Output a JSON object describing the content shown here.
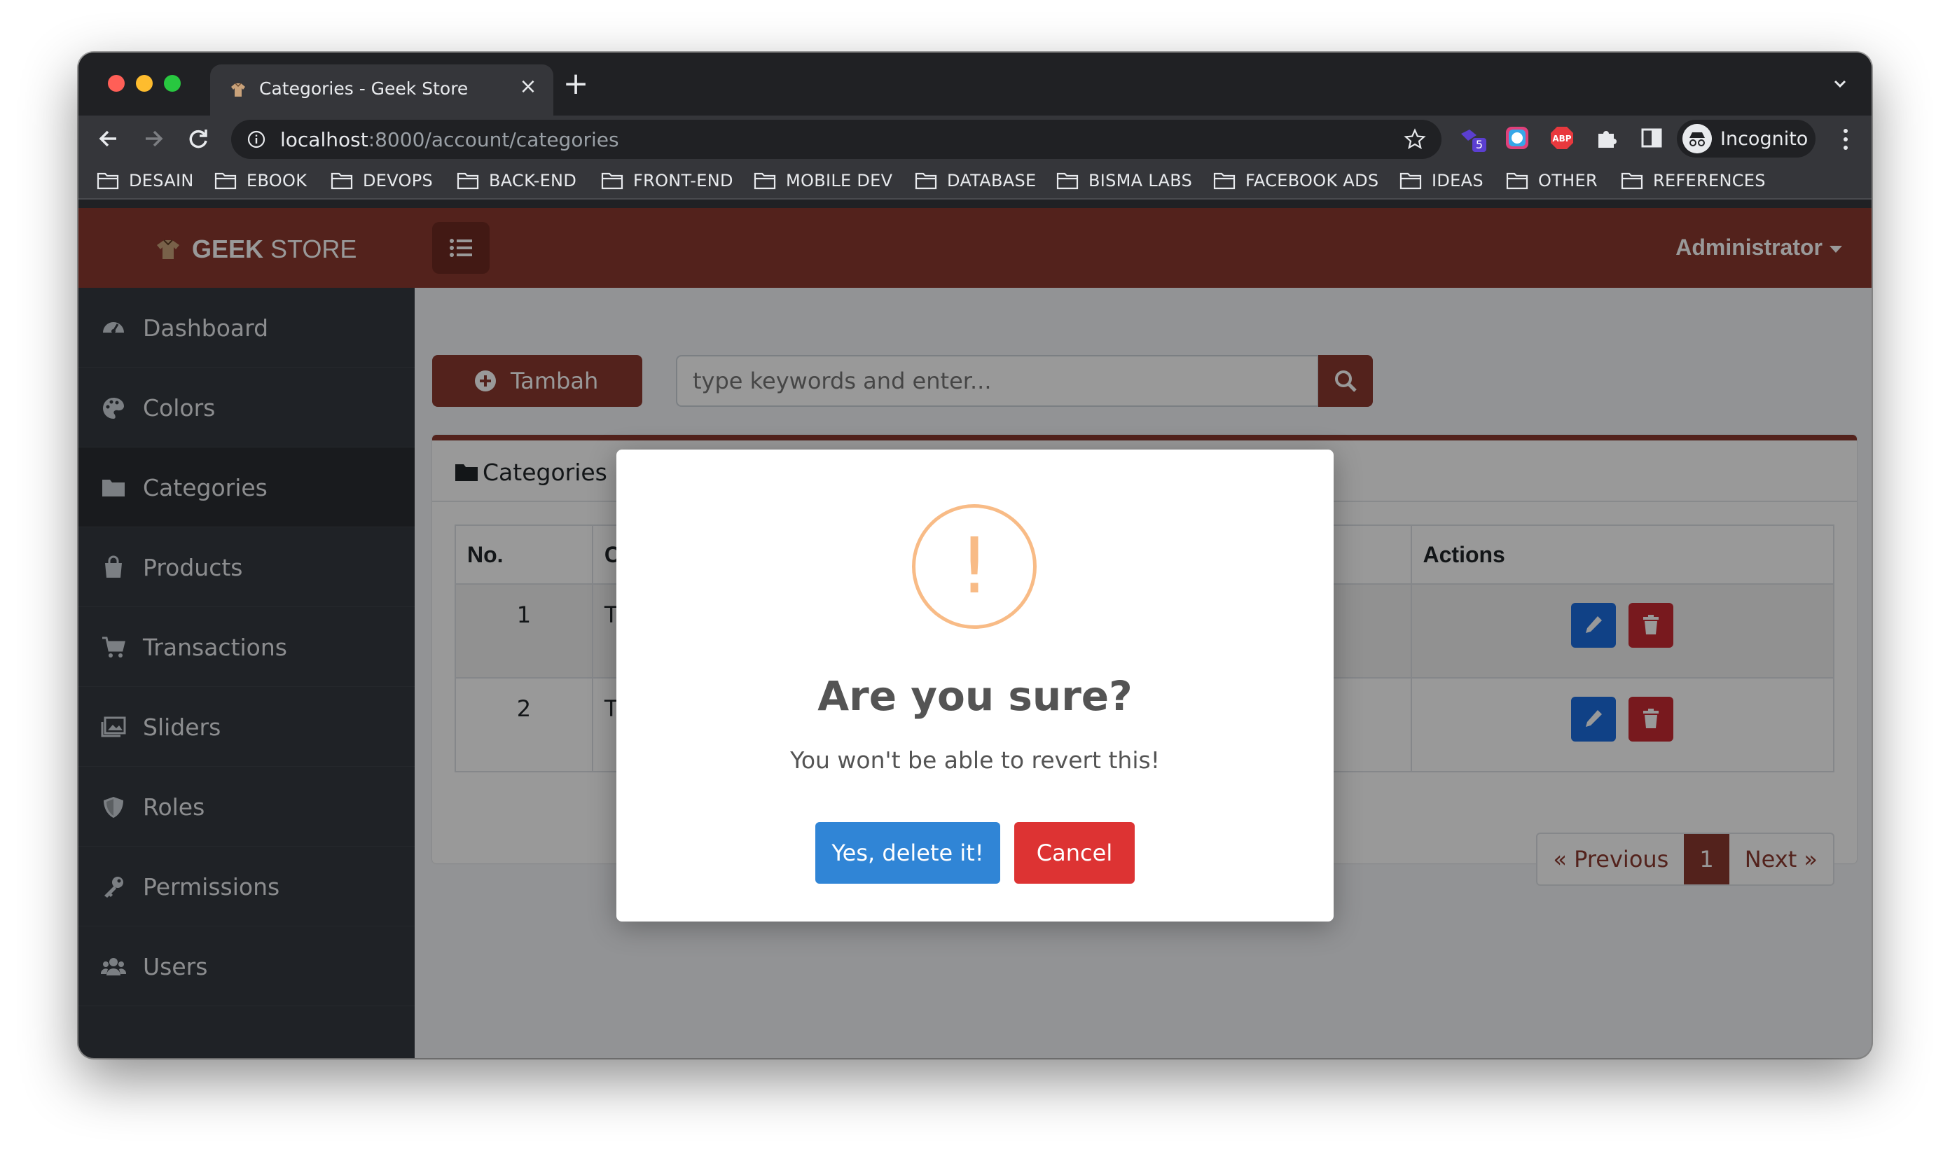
{
  "browser": {
    "tab_title": "Categories - Geek Store",
    "url_host": "localhost",
    "url_rest": ":8000/account/categories",
    "profile_label": "Incognito",
    "extension_badge": "5",
    "bookmarks": [
      "DESAIN",
      "EBOOK",
      "DEVOPS",
      "BACK-END",
      "FRONT-END",
      "MOBILE DEV",
      "DATABASE",
      "BISMA LABS",
      "FACEBOOK ADS",
      "IDEAS",
      "OTHER",
      "REFERENCES"
    ]
  },
  "navbar": {
    "brand_bold": "GEEK",
    "brand_light": " STORE",
    "user": "Administrator"
  },
  "sidebar": {
    "items": [
      {
        "label": "Dashboard",
        "icon": "dashboard-icon"
      },
      {
        "label": "Colors",
        "icon": "palette-icon"
      },
      {
        "label": "Categories",
        "icon": "folder-icon",
        "active": true
      },
      {
        "label": "Products",
        "icon": "shopping-bag-icon"
      },
      {
        "label": "Transactions",
        "icon": "cart-icon"
      },
      {
        "label": "Sliders",
        "icon": "images-icon"
      },
      {
        "label": "Roles",
        "icon": "shield-icon"
      },
      {
        "label": "Permissions",
        "icon": "key-icon"
      },
      {
        "label": "Users",
        "icon": "users-icon"
      }
    ]
  },
  "content": {
    "add_label": "Tambah",
    "search_placeholder": "type keywords and enter...",
    "card_title": "Categories",
    "table": {
      "headers": [
        "No.",
        "C",
        "Actions"
      ],
      "rows": [
        {
          "no": "1",
          "name": "T"
        },
        {
          "no": "2",
          "name": "T"
        }
      ]
    },
    "pagination": {
      "previous": "« Previous",
      "current": "1",
      "next": "Next »"
    }
  },
  "modal": {
    "icon_glyph": "!",
    "title": "Are you sure?",
    "text": "You won't be able to revert this!",
    "confirm": "Yes, delete it!",
    "cancel": "Cancel"
  },
  "colors": {
    "brand": "#8b3a2f",
    "confirm": "#3085d6",
    "cancel": "#dd3333",
    "warning": "#f8bb86"
  }
}
